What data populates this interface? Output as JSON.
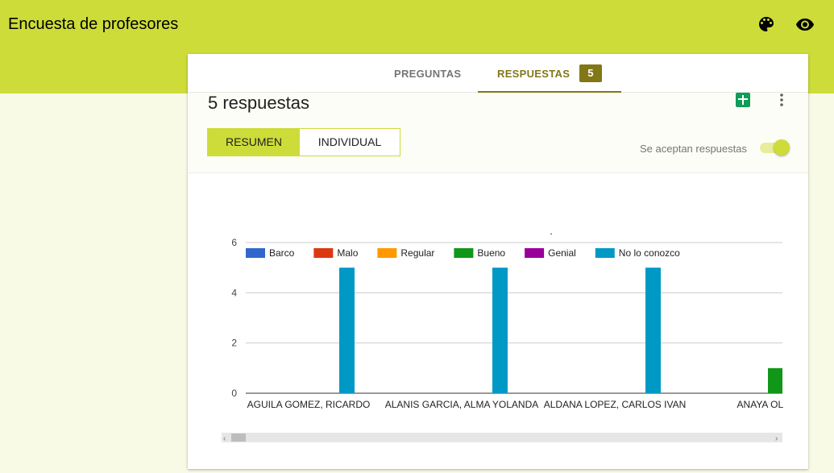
{
  "header": {
    "title": "Encuesta de profesores",
    "icons": [
      "palette-icon",
      "eye-icon"
    ],
    "background_color": "#cddc39"
  },
  "tabs": [
    {
      "label": "PREGUNTAS",
      "active": false
    },
    {
      "label": "RESPUESTAS",
      "active": true,
      "badge": "5"
    }
  ],
  "summary": {
    "response_count_text": "5 respuestas",
    "view_toggle": {
      "resumen": "RESUMEN",
      "individual": "INDIVIDUAL",
      "selected": "RESUMEN"
    },
    "accepting_label": "Se aceptan respuestas",
    "accepting": true,
    "icons": [
      "sheets-icon",
      "more-vert-icon"
    ]
  },
  "chart_data": {
    "type": "bar",
    "title": ".",
    "categories": [
      "AGUILA GOMEZ, RICARDO",
      "ALANIS GARCIA, ALMA YOLANDA",
      "ALDANA LOPEZ, CARLOS IVAN",
      "ANAYA OLIVE"
    ],
    "series": [
      {
        "name": "Barco",
        "color": "#3366cc",
        "values": [
          0,
          0,
          0,
          0
        ]
      },
      {
        "name": "Malo",
        "color": "#dc3912",
        "values": [
          0,
          0,
          0,
          0
        ]
      },
      {
        "name": "Regular",
        "color": "#ff9900",
        "values": [
          0,
          0,
          0,
          0
        ]
      },
      {
        "name": "Bueno",
        "color": "#109618",
        "values": [
          0,
          0,
          0,
          1
        ]
      },
      {
        "name": "Genial",
        "color": "#990099",
        "values": [
          0,
          0,
          0,
          0
        ]
      },
      {
        "name": "No lo conozco",
        "color": "#0099c6",
        "values": [
          5,
          5,
          5,
          0
        ]
      }
    ],
    "y_ticks": [
      "0",
      "2",
      "4",
      "6"
    ],
    "ylim": [
      0,
      6
    ],
    "grid": true,
    "legend_position": "top"
  }
}
